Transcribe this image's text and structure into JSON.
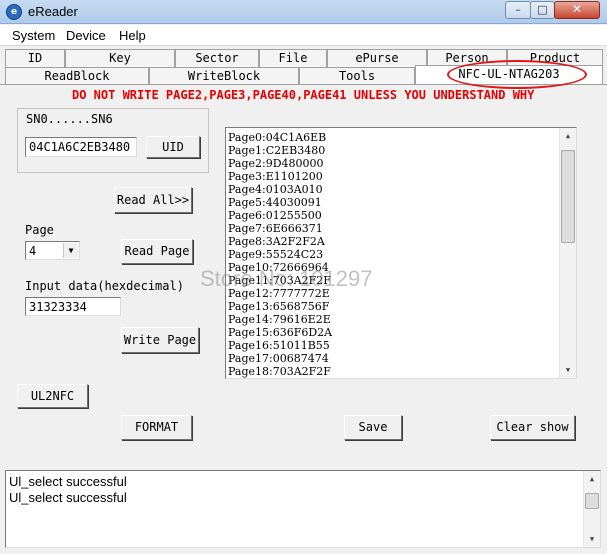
{
  "window": {
    "title": "eReader",
    "icon": "app-icon",
    "icon_glyph": "e",
    "min_glyph": "–",
    "max_glyph": "□",
    "close_glyph": "✕"
  },
  "menu": [
    "System",
    "Device",
    "Help"
  ],
  "tabs_top": [
    "ID",
    "Key",
    "Sector",
    "File",
    "ePurse",
    "Person",
    "Product"
  ],
  "tabs_bottom": [
    "ReadBlock",
    "WriteBlock",
    "Tools",
    "NFC-UL-NTAG203"
  ],
  "active_tab": "NFC-UL-NTAG203",
  "warning": "DO NOT WRITE PAGE2,PAGE3,PAGE40,PAGE41 UNLESS YOU UNDERSTAND WHY",
  "sn": {
    "label": "SN0......SN6",
    "value": "04C1A6C2EB3480",
    "uid_button": "UID"
  },
  "read_all_button": "Read All>>",
  "page": {
    "label": "Page",
    "selected": "4",
    "read_button": "Read Page"
  },
  "input": {
    "label": "Input data(hexdecimal)",
    "value": "31323334"
  },
  "write_button": "Write Page",
  "ul2nfc_button": "UL2NFC",
  "format_button": "FORMAT",
  "save_button": "Save",
  "clear_button": "Clear show",
  "pages": [
    "Page0:04C1A6EB",
    "Page1:C2EB3480",
    "Page2:9D480000",
    "Page3:E1101200",
    "Page4:0103A010",
    "Page5:44030091",
    "Page6:01255500",
    "Page7:6E666371",
    "Page8:3A2F2F2A",
    "Page9:55524C23",
    "Page10:72666964",
    "Page11:703A2F2F",
    "Page12:7777772E",
    "Page13:6568756F",
    "Page14:79616E2E",
    "Page15:636F6D2A",
    "Page16:51011B55",
    "Page17:00687474",
    "Page18:703A2F2F"
  ],
  "log": [
    "Ul_select successful",
    "Ul_select successful"
  ],
  "watermark": "Store No: 101297",
  "colors": {
    "warning": "#e80000",
    "annotation": "#e01818"
  }
}
